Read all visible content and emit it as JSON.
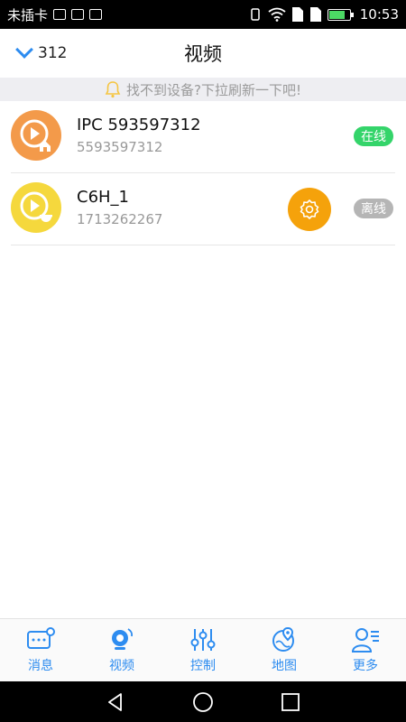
{
  "status_bar": {
    "carrier": "未插卡",
    "time": "10:53"
  },
  "header": {
    "count": "312",
    "title": "视频"
  },
  "hint": {
    "text": "找不到设备?下拉刷新一下吧!"
  },
  "devices": [
    {
      "name": "IPC 593597312",
      "id": "5593597312",
      "status": "在线",
      "icon": "home-camera-icon"
    },
    {
      "name": "C6H_1",
      "id": "1713262267",
      "status": "离线",
      "icon": "dome-camera-icon"
    }
  ],
  "tabs": [
    {
      "label": "消息",
      "icon": "message-icon"
    },
    {
      "label": "视频",
      "icon": "webcam-icon"
    },
    {
      "label": "控制",
      "icon": "sliders-icon"
    },
    {
      "label": "地图",
      "icon": "map-pin-icon"
    },
    {
      "label": "更多",
      "icon": "user-more-icon"
    }
  ],
  "colors": {
    "accent": "#2d8cf0",
    "online": "#34d46a",
    "offline": "#b5b5b5",
    "settings": "#f5a20b"
  }
}
